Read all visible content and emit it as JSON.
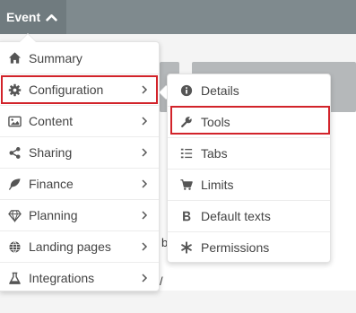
{
  "header": {
    "event_label": "Event",
    "event_icon": "chevron-up-icon"
  },
  "background": {
    "fragment_1": "b",
    "fragment_2": "/"
  },
  "menu": {
    "items": [
      {
        "label": "Summary",
        "icon": "home-icon",
        "has_submenu": false
      },
      {
        "label": "Configuration",
        "icon": "gear-icon",
        "has_submenu": true
      },
      {
        "label": "Content",
        "icon": "image-icon",
        "has_submenu": true
      },
      {
        "label": "Sharing",
        "icon": "share-icon",
        "has_submenu": true
      },
      {
        "label": "Finance",
        "icon": "leaf-icon",
        "has_submenu": true
      },
      {
        "label": "Planning",
        "icon": "diamond-icon",
        "has_submenu": true
      },
      {
        "label": "Landing pages",
        "icon": "globe-icon",
        "has_submenu": true
      },
      {
        "label": "Integrations",
        "icon": "flask-icon",
        "has_submenu": true
      }
    ]
  },
  "submenu": {
    "items": [
      {
        "label": "Details",
        "icon": "info-circle-icon"
      },
      {
        "label": "Tools",
        "icon": "wrench-icon"
      },
      {
        "label": "Tabs",
        "icon": "list-icon"
      },
      {
        "label": "Limits",
        "icon": "cart-icon"
      },
      {
        "label": "Default texts",
        "icon": "bold-b-icon"
      },
      {
        "label": "Permissions",
        "icon": "asterisk-icon"
      }
    ]
  },
  "colors": {
    "topbar": "#7f8a8e",
    "highlight": "#d2232a",
    "text": "#444444",
    "icon": "#555555"
  }
}
